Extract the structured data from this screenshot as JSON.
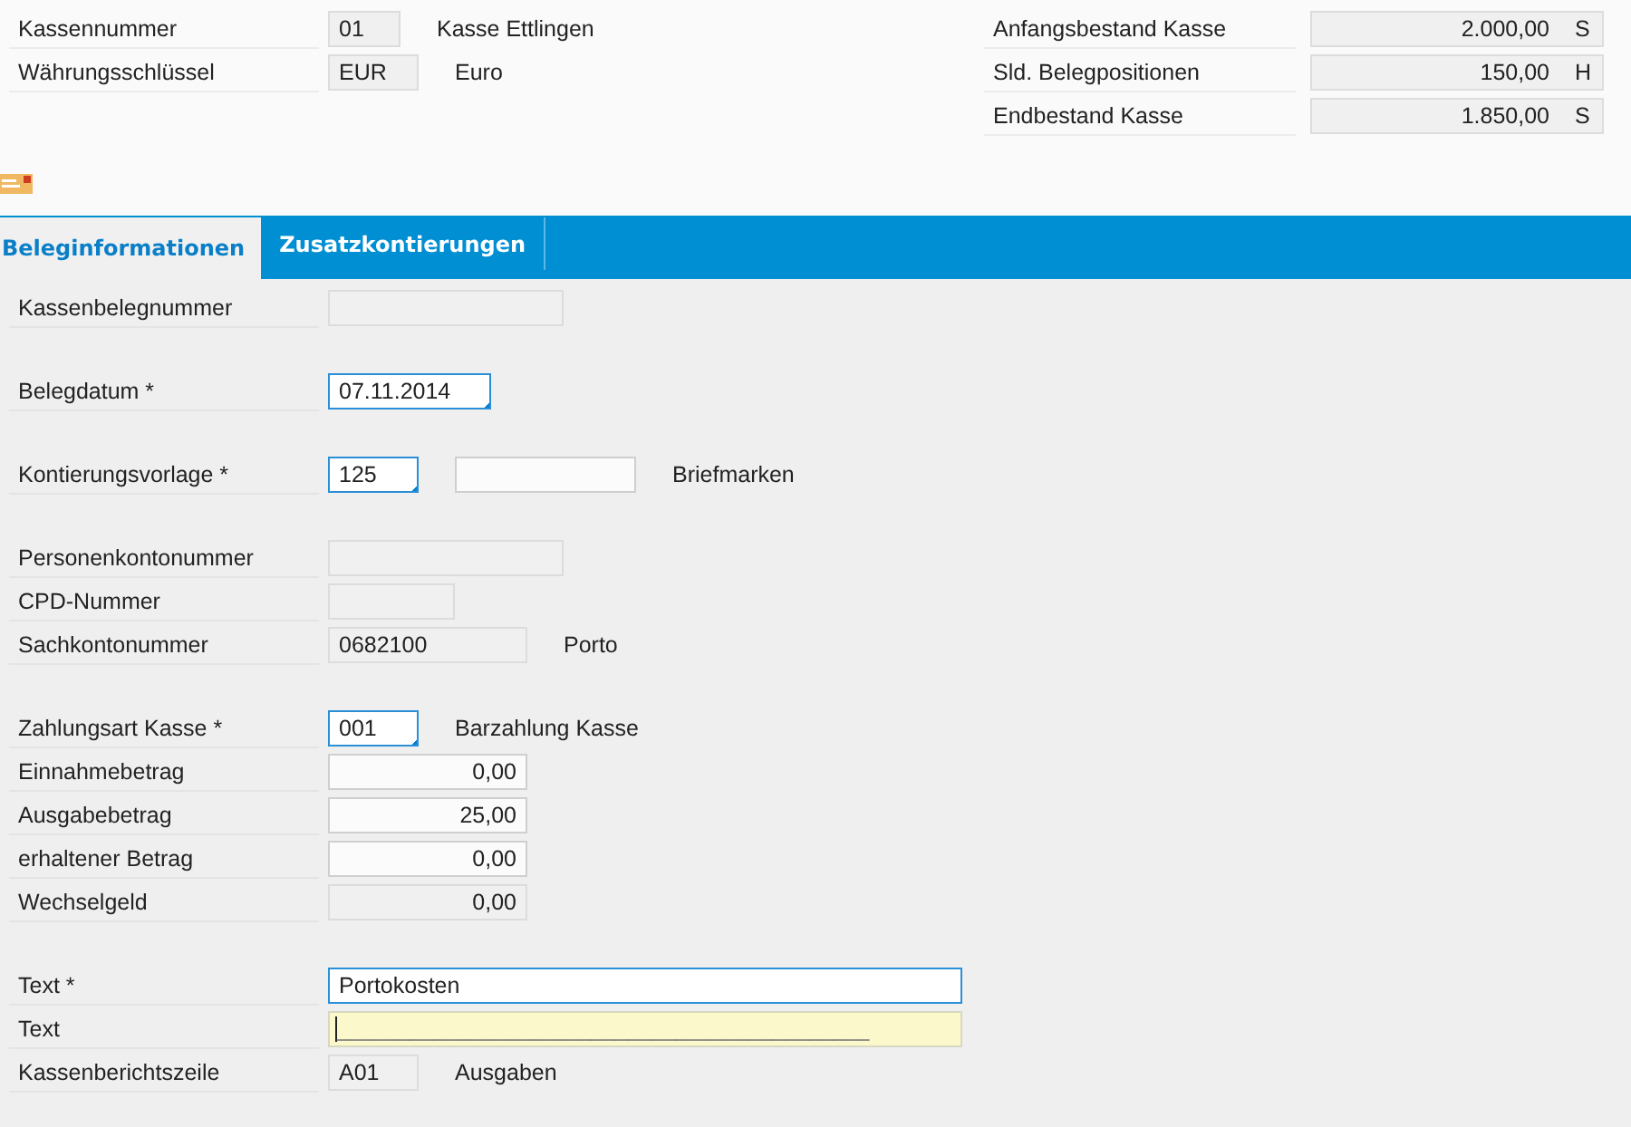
{
  "header_left": [
    {
      "label": "Kassennummer",
      "value": "01",
      "description": "Kasse Ettlingen"
    },
    {
      "label": "Währungsschlüssel",
      "value": "EUR",
      "description": "Euro"
    }
  ],
  "header_right": [
    {
      "label": "Anfangsbestand Kasse",
      "value": "2.000,00",
      "side": "S"
    },
    {
      "label": "Sld. Belegpositionen",
      "value": "150,00",
      "side": "H"
    },
    {
      "label": "Endbestand Kasse",
      "value": "1.850,00",
      "side": "S"
    }
  ],
  "tabs": [
    {
      "label": "Beleginformationen",
      "selected": true
    },
    {
      "label": "Zusatzkontierungen",
      "selected": false
    }
  ],
  "groups": [
    {
      "rows": [
        {
          "label": "Kassenbelegnummer",
          "field": {
            "kind": "display"
          }
        }
      ]
    },
    {
      "rows": [
        {
          "label": "Belegdatum *",
          "field": {
            "kind": "value_help",
            "value": "07.11.2014"
          }
        }
      ]
    },
    {
      "rows": [
        {
          "label": "Kontierungsvorlage *",
          "field": {
            "kind": "value_help",
            "value": "125"
          },
          "extra_field": {
            "kind": "input"
          },
          "description": "Briefmarken"
        }
      ]
    },
    {
      "rows": [
        {
          "label": "Personenkontonummer",
          "field": {
            "kind": "display"
          }
        },
        {
          "label": "CPD-Nummer",
          "field": {
            "kind": "display"
          }
        },
        {
          "label": "Sachkontonummer",
          "field": {
            "kind": "display",
            "value": "0682100"
          },
          "description": "Porto"
        }
      ]
    },
    {
      "rows": [
        {
          "label": "Zahlungsart Kasse *",
          "field": {
            "kind": "value_help",
            "value": "001"
          },
          "description": "Barzahlung Kasse"
        },
        {
          "label": "Einnahmebetrag",
          "field": {
            "kind": "amount_input",
            "value": "0,00"
          }
        },
        {
          "label": "Ausgabebetrag",
          "field": {
            "kind": "amount_input",
            "value": "25,00"
          }
        },
        {
          "label": "erhaltener Betrag",
          "field": {
            "kind": "amount_input",
            "value": "0,00"
          }
        },
        {
          "label": "Wechselgeld",
          "field": {
            "kind": "amount_display",
            "value": "0,00"
          }
        }
      ]
    },
    {
      "rows": [
        {
          "label": "Text *",
          "field": {
            "kind": "required_input",
            "value": "Portokosten"
          }
        },
        {
          "label": "Text",
          "field": {
            "kind": "focused",
            "placeholder": "____________________________________________"
          }
        },
        {
          "label": "Kassenberichtszeile",
          "field": {
            "kind": "display",
            "value": "A01"
          },
          "description": "Ausgaben"
        }
      ]
    }
  ]
}
